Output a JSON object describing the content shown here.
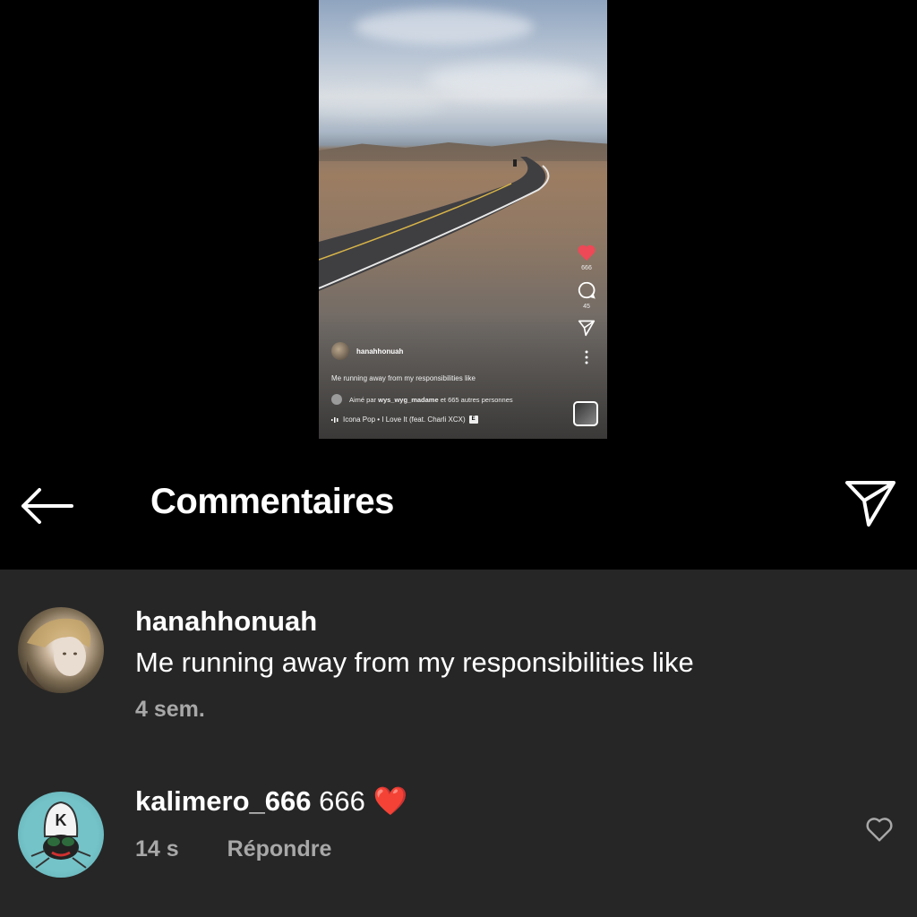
{
  "reel": {
    "likes_count": "666",
    "comments_count": "45",
    "author": "hanahhonuah",
    "caption": "Me running away from my responsibilities like",
    "liked_prefix": "Aimé par",
    "liked_user": "wys_wyg_madame",
    "liked_suffix": "et 665 autres personnes",
    "music": "Icona Pop • I Love It (feat. Charli XCX)",
    "explicit_badge": "E",
    "accent_color": "#ed4956"
  },
  "header": {
    "title": "Commentaires"
  },
  "comments": [
    {
      "username": "hanahhonuah",
      "text": "Me running away from my responsibilities like",
      "time": "4 sem."
    },
    {
      "username": "kalimero_666",
      "text": "666 ❤️",
      "time": "14 s",
      "reply_label": "Répondre"
    }
  ],
  "icons": [
    "back-arrow-icon",
    "send-icon",
    "heart-icon",
    "comment-icon",
    "more-icon"
  ]
}
